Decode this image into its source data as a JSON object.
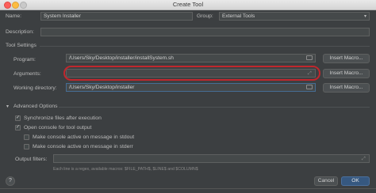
{
  "window": {
    "title": "Create Tool"
  },
  "form": {
    "name_label": "Name:",
    "name_value": "System Installer",
    "group_label": "Group:",
    "group_value": "External Tools",
    "description_label": "Description:",
    "description_value": ""
  },
  "tool_settings": {
    "header": "Tool Settings",
    "program_label": "Program:",
    "program_value": "/Users/Sky/Desktop/installer/installSystem.sh",
    "arguments_label": "Arguments:",
    "arguments_value": "",
    "workdir_label": "Working directory:",
    "workdir_value": "/Users/Sky/Desktop/installer",
    "insert_macro_label": "Insert Macro..."
  },
  "advanced": {
    "header": "Advanced Options",
    "sync_label": "Synchronize files after execution",
    "sync_checked": true,
    "console_label": "Open console for tool output",
    "console_checked": true,
    "stdout_label": "Make console active on message in stdout",
    "stdout_checked": false,
    "stderr_label": "Make console active on message in stderr",
    "stderr_checked": false,
    "output_filters_label": "Output filters:",
    "output_filters_value": "",
    "hint": "Each line is a regex, available macros: $FILE_PATH$, $LINE$ and $COLUMN$"
  },
  "buttons": {
    "help": "?",
    "cancel": "Cancel",
    "ok": "OK"
  },
  "colors": {
    "highlight": "#c0272d",
    "accent": "#365880"
  }
}
